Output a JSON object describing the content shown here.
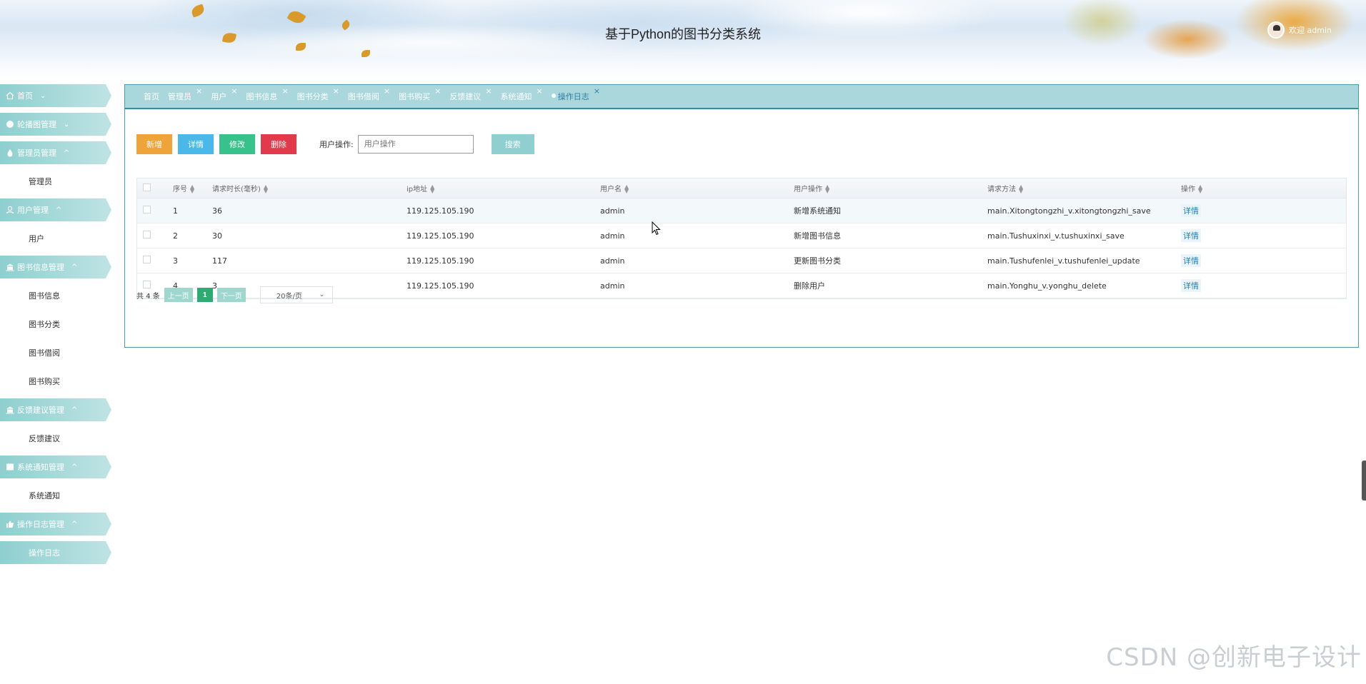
{
  "header": {
    "title": "基于Python的图书分类系统",
    "welcome": "欢迎 admin"
  },
  "sidebar": {
    "groups": [
      {
        "label": "首页",
        "icon": "home-icon",
        "caret": "⌄"
      },
      {
        "label": "轮播图管理",
        "icon": "circle-icon",
        "caret": "⌄"
      },
      {
        "label": "管理员管理",
        "icon": "drop-icon",
        "caret": "^",
        "items": [
          "管理员"
        ]
      },
      {
        "label": "用户管理",
        "icon": "user-icon",
        "caret": "^",
        "items": [
          "用户"
        ]
      },
      {
        "label": "图书信息管理",
        "icon": "bank-icon",
        "caret": "^",
        "items": [
          "图书信息",
          "图书分类",
          "图书借阅",
          "图书购买"
        ]
      },
      {
        "label": "反馈建议管理",
        "icon": "bank-icon",
        "caret": "^",
        "items": [
          "反馈建议"
        ]
      },
      {
        "label": "系统通知管理",
        "icon": "table-icon",
        "caret": "^",
        "items": [
          "系统通知"
        ]
      },
      {
        "label": "操作日志管理",
        "icon": "thumb-icon",
        "caret": "^",
        "items": [
          "操作日志"
        ]
      }
    ]
  },
  "tabs": [
    {
      "label": "首页",
      "closable": false
    },
    {
      "label": "管理员",
      "closable": true
    },
    {
      "label": "用户",
      "closable": true
    },
    {
      "label": "图书信息",
      "closable": true
    },
    {
      "label": "图书分类",
      "closable": true
    },
    {
      "label": "图书借阅",
      "closable": true
    },
    {
      "label": "图书购买",
      "closable": true
    },
    {
      "label": "反馈建议",
      "closable": true
    },
    {
      "label": "系统通知",
      "closable": true
    },
    {
      "label": "操作日志",
      "closable": true,
      "active": true
    }
  ],
  "toolbar": {
    "add": "新增",
    "detail": "详情",
    "edit": "修改",
    "delete": "删除",
    "search_label": "用户操作:",
    "search_placeholder": "用户操作",
    "search_button": "搜索"
  },
  "table": {
    "headers": [
      "序号",
      "请求时长(毫秒)",
      "ip地址",
      "用户名",
      "用户操作",
      "请求方法",
      "操作"
    ],
    "rows": [
      {
        "idx": "1",
        "duration": "36",
        "ip": "119.125.105.190",
        "user": "admin",
        "op": "新增系统通知",
        "method": "main.Xitongtongzhi_v.xitongtongzhi_save",
        "action": "详情"
      },
      {
        "idx": "2",
        "duration": "30",
        "ip": "119.125.105.190",
        "user": "admin",
        "op": "新增图书信息",
        "method": "main.Tushuxinxi_v.tushuxinxi_save",
        "action": "详情"
      },
      {
        "idx": "3",
        "duration": "117",
        "ip": "119.125.105.190",
        "user": "admin",
        "op": "更新图书分类",
        "method": "main.Tushufenlei_v.tushufenlei_update",
        "action": "详情"
      },
      {
        "idx": "4",
        "duration": "3",
        "ip": "119.125.105.190",
        "user": "admin",
        "op": "删除用户",
        "method": "main.Yonghu_v.yonghu_delete",
        "action": "详情"
      }
    ]
  },
  "pager": {
    "total": "共 4 条",
    "prev": "上一页",
    "current": "1",
    "next": "下一页",
    "page_size": "20条/页"
  },
  "watermark": "CSDN @创新电子设计",
  "colors": {
    "accent": "#8fcfcf",
    "tabbar": "#a9d7dc",
    "add": "#efa43a",
    "detail": "#4ab8e8",
    "edit": "#36c28a",
    "delete": "#e13a4a",
    "current_page": "#2eaa73"
  }
}
